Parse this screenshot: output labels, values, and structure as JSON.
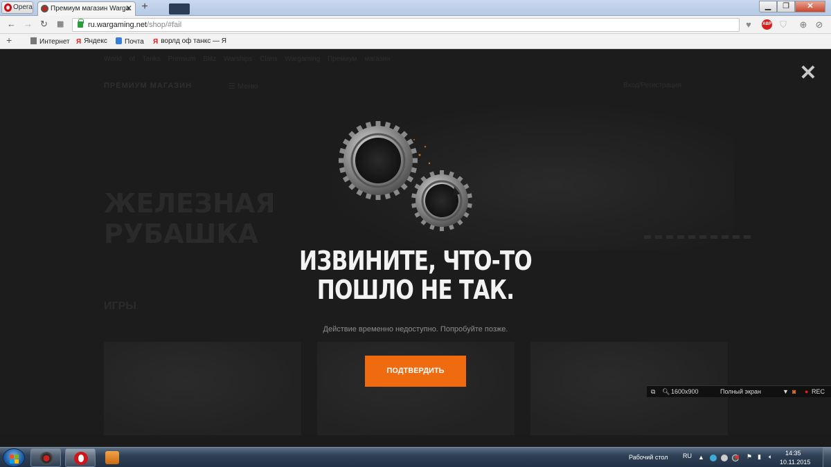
{
  "browser": {
    "menu_label": "Opera",
    "tab_title": "Премиум магазин Warga",
    "new_tab_symbol": "+",
    "tab_close_symbol": "✕",
    "window_controls": [
      "▁",
      "❐",
      "✕"
    ],
    "url_host": "ru.wargaming.net",
    "url_path": "/shop/#fail",
    "abp_label": "ABP"
  },
  "bookmarks": {
    "add_symbol": "+",
    "items": [
      {
        "label": "Интернет",
        "icon": "document-icon"
      },
      {
        "label": "Яндекс",
        "icon": "yandex-icon"
      },
      {
        "label": "Почта",
        "icon": "mail-icon"
      },
      {
        "label": "ворлд оф танкс — Я",
        "icon": "yandex-icon"
      }
    ]
  },
  "background_page": {
    "top_nav": "World of Tanks   Premium   Blitz   Warships   Clans   Wargaming   Премиум магазин",
    "shop_logo": "ПРЕМИУМ МАГАЗИН",
    "menu": "Меню",
    "account": "Вход/Регистрация",
    "hero_line1": "ЖЕЛЕЗНАЯ",
    "hero_line2": "РУБАШКА",
    "games_heading": "ИГРЫ"
  },
  "modal": {
    "close_symbol": "✕",
    "title_line1": "ИЗВИНИТЕ, ЧТО-ТО",
    "title_line2": "ПОШЛО НЕ ТАК.",
    "subtitle": "Действие временно недоступно. Попробуйте позже.",
    "confirm_label": "ПОДТВЕРДИТЬ"
  },
  "recorder": {
    "resolution": "1600x900",
    "mode": "Полный экран",
    "rec_label": "REC"
  },
  "taskbar": {
    "desktop_label": "Рабочий стол",
    "lang": "RU",
    "time": "14:35",
    "date": "10.11.2015"
  },
  "colors": {
    "accent_orange": "#f06a0f",
    "page_bg": "#1c1c1c",
    "title_text": "#f2f2f2"
  }
}
